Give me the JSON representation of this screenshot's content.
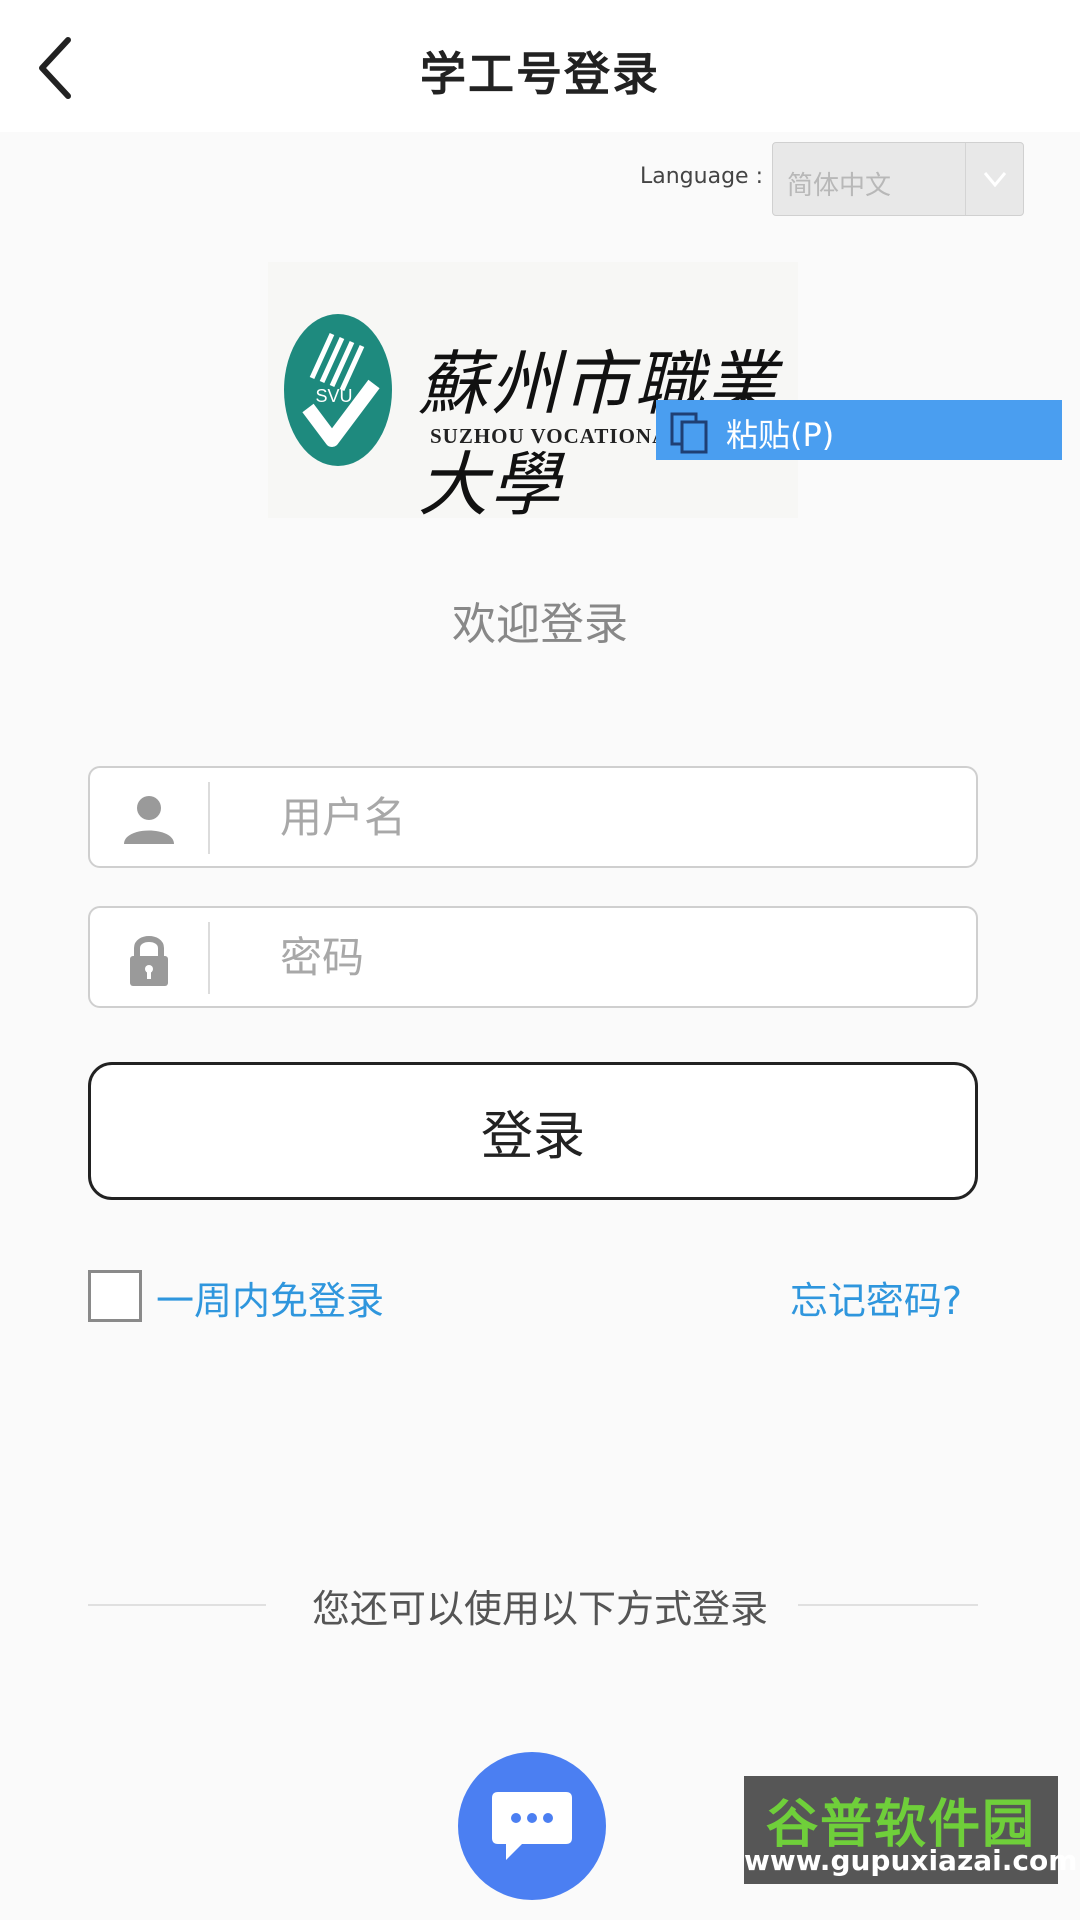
{
  "header": {
    "title": "学工号登录",
    "back_icon": "chevron-left-icon"
  },
  "language": {
    "label": "Language :",
    "selected": "简体中文",
    "caret_icon": "chevron-down-icon"
  },
  "logo": {
    "name_cn": "蘇州市職業大學",
    "name_en": "SUZHOU VOCATIONAL UNIVERSITY",
    "emblem_text": "SVU",
    "emblem_color": "#1e8a7e"
  },
  "context_menu": {
    "label": "粘贴(P)",
    "icon": "paste-icon",
    "color": "#4a9ef0"
  },
  "welcome": "欢迎登录",
  "form": {
    "username_placeholder": "用户名",
    "password_placeholder": "密码",
    "user_icon": "user-icon",
    "lock_icon": "lock-icon",
    "login_label": "登录",
    "remember_label": "一周内免登录",
    "forgot_label": "忘记密码?",
    "link_color": "#2f96dd"
  },
  "other_login": {
    "text": "您还可以使用以下方式登录",
    "chat_icon": "chat-bubble-icon",
    "chat_color": "#4b7ff2"
  },
  "watermark": {
    "brand": "谷普软件园",
    "url": "www.gupuxiazai.com"
  }
}
